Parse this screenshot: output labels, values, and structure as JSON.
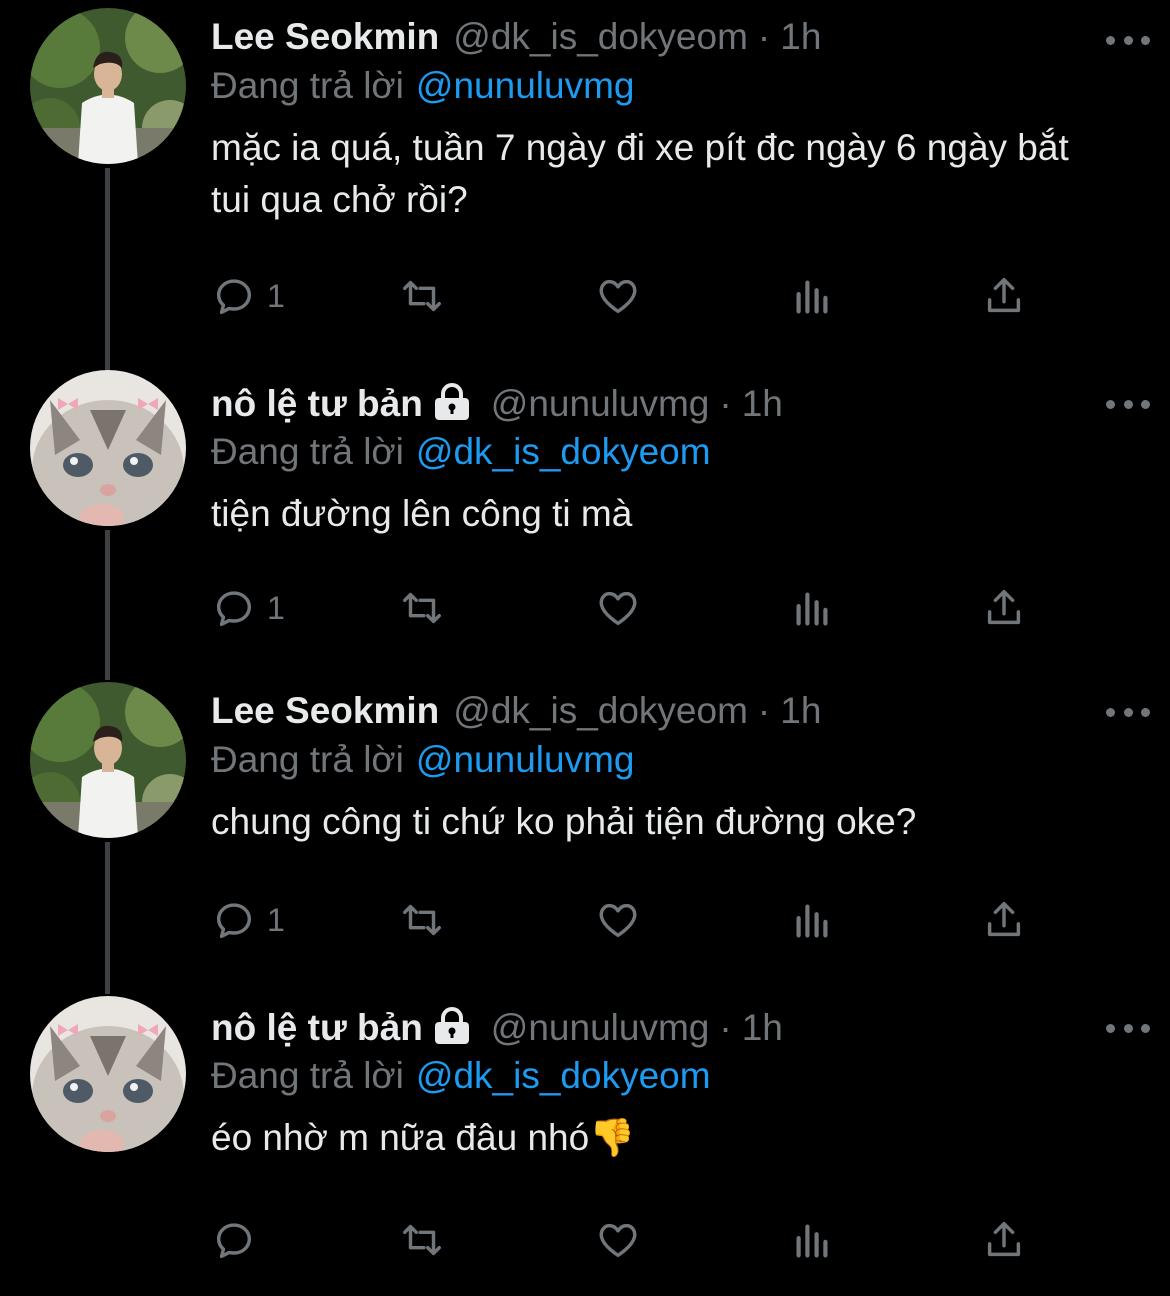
{
  "colors": {
    "background": "#000000",
    "text_primary": "#e7e9ea",
    "text_secondary": "#71767b",
    "link": "#1d9bf0",
    "thread_line": "#3d4144"
  },
  "tweets": [
    {
      "name": "Lee Seokmin",
      "protected": false,
      "handle": "@dk_is_dokyeom",
      "separator": "·",
      "time": "1h",
      "reply_prefix": "Đang trả lời",
      "reply_to": "@nunuluvmg",
      "text": "mặc ia quá, tuần 7 ngày đi xe pít đc ngày 6 ngày bắt tui qua chở rồi?",
      "reply_count": "1",
      "avatar_icon": "profile-photo-man"
    },
    {
      "name": "nô lệ tư bản",
      "protected": true,
      "handle": "@nunuluvmg",
      "separator": "·",
      "time": "1h",
      "reply_prefix": "Đang trả lời",
      "reply_to": "@dk_is_dokyeom",
      "text": "tiện đường lên công ti mà",
      "reply_count": "1",
      "avatar_icon": "profile-photo-kitten"
    },
    {
      "name": "Lee Seokmin",
      "protected": false,
      "handle": "@dk_is_dokyeom",
      "separator": "·",
      "time": "1h",
      "reply_prefix": "Đang trả lời",
      "reply_to": "@nunuluvmg",
      "text": "chung công ti chứ ko phải tiện đường oke?",
      "reply_count": "1",
      "avatar_icon": "profile-photo-man"
    },
    {
      "name": "nô lệ tư bản",
      "protected": true,
      "handle": "@nunuluvmg",
      "separator": "·",
      "time": "1h",
      "reply_prefix": "Đang trả lời",
      "reply_to": "@dk_is_dokyeom",
      "text": "éo nhờ m nữa đâu nhó👎",
      "reply_count": "",
      "avatar_icon": "profile-photo-kitten"
    }
  ]
}
